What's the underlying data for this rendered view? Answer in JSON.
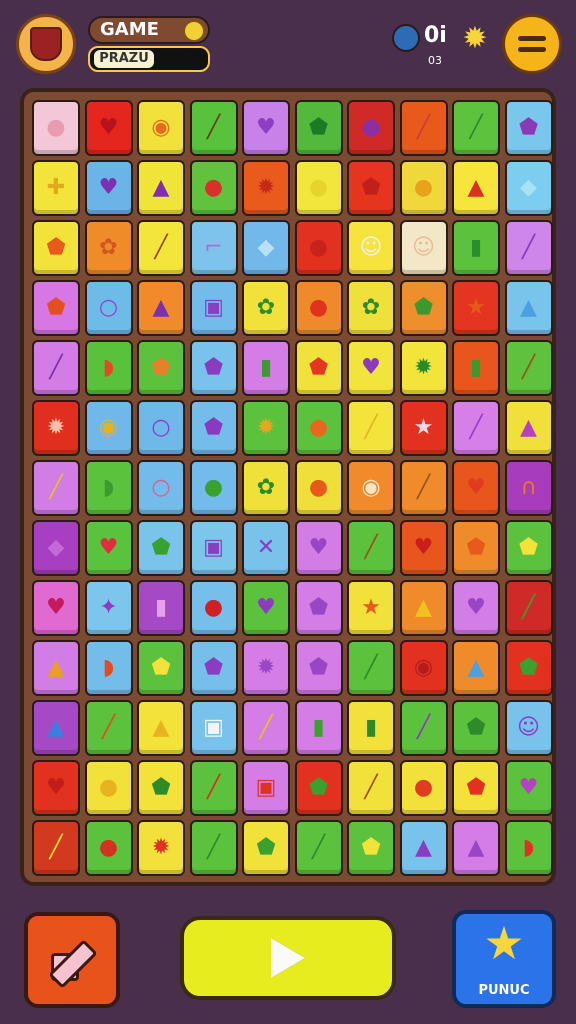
{
  "header": {
    "title": "GAME",
    "subtitle": "PRAZU",
    "stat_value": "0i",
    "stat_sub": "03"
  },
  "buttons": {
    "right_label": "PUNUC"
  },
  "board": {
    "rows": [
      [
        {
          "bg": "#f2c8d8",
          "icon": "●",
          "ic": "#e99bb2"
        },
        {
          "bg": "#e4261e",
          "icon": "♥",
          "ic": "#b5121d"
        },
        {
          "bg": "#f0e23a",
          "icon": "◉",
          "ic": "#e86a1e"
        },
        {
          "bg": "#58c23c",
          "icon": "╱",
          "ic": "#6b3b12"
        },
        {
          "bg": "#c781e8",
          "icon": "♥",
          "ic": "#8d3fc4"
        },
        {
          "bg": "#52b93d",
          "icon": "⬟",
          "ic": "#1b7a26"
        },
        {
          "bg": "#cf2a27",
          "icon": "●",
          "ic": "#8b2fa6"
        },
        {
          "bg": "#e85a1c",
          "icon": "╱",
          "ic": "#d43838"
        },
        {
          "bg": "#5dc23d",
          "icon": "╱",
          "ic": "#2f8a29"
        },
        {
          "bg": "#7ac7ee",
          "icon": "⬟",
          "ic": "#8c39b8"
        }
      ],
      [
        {
          "bg": "#f2e43a",
          "icon": "✚",
          "ic": "#e4a81c"
        },
        {
          "bg": "#6bb4e8",
          "icon": "♥",
          "ic": "#7e2fb3"
        },
        {
          "bg": "#f1e438",
          "icon": "▲",
          "ic": "#7d2fb1"
        },
        {
          "bg": "#61c23e",
          "icon": "●",
          "ic": "#d8312c"
        },
        {
          "bg": "#e95a1c",
          "icon": "✹",
          "ic": "#c42a1a"
        },
        {
          "bg": "#f2e63c",
          "icon": "●",
          "ic": "#e5d42d"
        },
        {
          "bg": "#e6351f",
          "icon": "⬟",
          "ic": "#c21e1a"
        },
        {
          "bg": "#f0d83c",
          "icon": "●",
          "ic": "#e9a31a"
        },
        {
          "bg": "#f6e53b",
          "icon": "▲",
          "ic": "#d8311f"
        },
        {
          "bg": "#7ccdef",
          "icon": "◆",
          "ic": "#a6e3f6"
        }
      ],
      [
        {
          "bg": "#f2e23a",
          "icon": "⬟",
          "ic": "#e85a1c"
        },
        {
          "bg": "#f08b2a",
          "icon": "✿",
          "ic": "#d2571e"
        },
        {
          "bg": "#f3e539",
          "icon": "╱",
          "ic": "#8a4918"
        },
        {
          "bg": "#7ec3ec",
          "icon": "⌐",
          "ic": "#b06ad8"
        },
        {
          "bg": "#72b8ea",
          "icon": "◆",
          "ic": "#b9e1f4"
        },
        {
          "bg": "#e2311f",
          "icon": "●",
          "ic": "#c7221b"
        },
        {
          "bg": "#f6e43d",
          "icon": "☺",
          "ic": "#f1f1f1"
        },
        {
          "bg": "#f2e8c8",
          "icon": "☺",
          "ic": "#e9b99a"
        },
        {
          "bg": "#5cc23e",
          "icon": "▮",
          "ic": "#2b8e2e"
        },
        {
          "bg": "#cf86ea",
          "icon": "╱",
          "ic": "#8c38bd"
        }
      ],
      [
        {
          "bg": "#d677e4",
          "icon": "⬟",
          "ic": "#e34f1f"
        },
        {
          "bg": "#6dbbe9",
          "icon": "○",
          "ic": "#9a40c4"
        },
        {
          "bg": "#f08a2a",
          "icon": "▲",
          "ic": "#7b2fb1"
        },
        {
          "bg": "#72bbeb",
          "icon": "▣",
          "ic": "#8d3bc0"
        },
        {
          "bg": "#f1e13a",
          "icon": "✿",
          "ic": "#2e8f29"
        },
        {
          "bg": "#ee8a2b",
          "icon": "●",
          "ic": "#e0331c"
        },
        {
          "bg": "#f0e03a",
          "icon": "✿",
          "ic": "#2c8a2a"
        },
        {
          "bg": "#ef8e2c",
          "icon": "⬟",
          "ic": "#3a9a2e"
        },
        {
          "bg": "#e3351f",
          "icon": "★",
          "ic": "#e55a1a"
        },
        {
          "bg": "#78c4ec",
          "icon": "▲",
          "ic": "#4aa0e0"
        }
      ],
      [
        {
          "bg": "#d47ce6",
          "icon": "╱",
          "ic": "#7e2fa8"
        },
        {
          "bg": "#58c23c",
          "icon": "◗",
          "ic": "#e54a20"
        },
        {
          "bg": "#5cc23e",
          "icon": "⬟",
          "ic": "#e87f2a"
        },
        {
          "bg": "#78c2ec",
          "icon": "⬟",
          "ic": "#8a3cc0"
        },
        {
          "bg": "#d47de6",
          "icon": "▮",
          "ic": "#3c9a2e"
        },
        {
          "bg": "#f0e23a",
          "icon": "⬟",
          "ic": "#e53620"
        },
        {
          "bg": "#f2e43b",
          "icon": "♥",
          "ic": "#8b3ac0"
        },
        {
          "bg": "#f2e43a",
          "icon": "✹",
          "ic": "#2c8a2a"
        },
        {
          "bg": "#e9561d",
          "icon": "▮",
          "ic": "#3a9a2e"
        },
        {
          "bg": "#5fc23e",
          "icon": "╱",
          "ic": "#9a5418"
        }
      ],
      [
        {
          "bg": "#e02e1f",
          "icon": "✹",
          "ic": "#ffbfa8"
        },
        {
          "bg": "#71b8ea",
          "icon": "◉",
          "ic": "#e8b21f"
        },
        {
          "bg": "#6fb9ea",
          "icon": "○",
          "ic": "#8b3cc0"
        },
        {
          "bg": "#74bdeb",
          "icon": "⬟",
          "ic": "#8a3ac0"
        },
        {
          "bg": "#5cc23e",
          "icon": "✹",
          "ic": "#e8a71f"
        },
        {
          "bg": "#5cc23e",
          "icon": "●",
          "ic": "#e9661f"
        },
        {
          "bg": "#f3e33a",
          "icon": "╱",
          "ic": "#e6b421"
        },
        {
          "bg": "#e2311f",
          "icon": "★",
          "ic": "#f5d8e6"
        },
        {
          "bg": "#d67fe8",
          "icon": "╱",
          "ic": "#9a3fc3"
        },
        {
          "bg": "#f1e03a",
          "icon": "▲",
          "ic": "#b541c3"
        }
      ],
      [
        {
          "bg": "#d27ce6",
          "icon": "╱",
          "ic": "#e8c11f"
        },
        {
          "bg": "#5bc23e",
          "icon": "◗",
          "ic": "#3c9a2e"
        },
        {
          "bg": "#72bbea",
          "icon": "○",
          "ic": "#e25a8f"
        },
        {
          "bg": "#72bbea",
          "icon": "●",
          "ic": "#3aa02e"
        },
        {
          "bg": "#f0e03a",
          "icon": "✿",
          "ic": "#2c8a2a"
        },
        {
          "bg": "#f0de3b",
          "icon": "●",
          "ic": "#e85a1c"
        },
        {
          "bg": "#f08a2a",
          "icon": "◉",
          "ic": "#f5e6c8"
        },
        {
          "bg": "#ef8b2b",
          "icon": "╱",
          "ic": "#9a5418"
        },
        {
          "bg": "#e8561d",
          "icon": "♥",
          "ic": "#e03c1f"
        },
        {
          "bg": "#a73dbd",
          "icon": "∩",
          "ic": "#e87a1f"
        }
      ],
      [
        {
          "bg": "#a83fc2",
          "icon": "◆",
          "ic": "#c46ad8"
        },
        {
          "bg": "#5bc23e",
          "icon": "♥",
          "ic": "#e12e3f"
        },
        {
          "bg": "#7ac4ec",
          "icon": "⬟",
          "ic": "#3aa02e"
        },
        {
          "bg": "#7cc6ec",
          "icon": "▣",
          "ic": "#8d3bc0"
        },
        {
          "bg": "#78c2ec",
          "icon": "✕",
          "ic": "#8b3cc0"
        },
        {
          "bg": "#d27ce6",
          "icon": "♥",
          "ic": "#9a44c6"
        },
        {
          "bg": "#5cc23e",
          "icon": "╱",
          "ic": "#9a5418"
        },
        {
          "bg": "#e9561d",
          "icon": "♥",
          "ic": "#c91e1e"
        },
        {
          "bg": "#ef8b2b",
          "icon": "⬟",
          "ic": "#e85a1c"
        },
        {
          "bg": "#5cc23e",
          "icon": "⬟",
          "ic": "#f2e23a"
        }
      ],
      [
        {
          "bg": "#e06ad2",
          "icon": "♥",
          "ic": "#c41b5c"
        },
        {
          "bg": "#7cc5ec",
          "icon": "✦",
          "ic": "#8b3cc0"
        },
        {
          "bg": "#a54ac4",
          "icon": "▮",
          "ic": "#e7a0ea"
        },
        {
          "bg": "#76bfeb",
          "icon": "●",
          "ic": "#cf2024"
        },
        {
          "bg": "#5cc23e",
          "icon": "♥",
          "ic": "#8d3bc0"
        },
        {
          "bg": "#d47de6",
          "icon": "⬟",
          "ic": "#9a44c6"
        },
        {
          "bg": "#f1e13a",
          "icon": "★",
          "ic": "#e65a1c"
        },
        {
          "bg": "#ef8b2b",
          "icon": "▲",
          "ic": "#f0c41f"
        },
        {
          "bg": "#d37de6",
          "icon": "♥",
          "ic": "#9a44c6"
        },
        {
          "bg": "#cf2a27",
          "icon": "╱",
          "ic": "#3aa02e"
        }
      ],
      [
        {
          "bg": "#d27de6",
          "icon": "▲",
          "ic": "#e9a01f"
        },
        {
          "bg": "#74bdeb",
          "icon": "◗",
          "ic": "#e54a20"
        },
        {
          "bg": "#5cc23e",
          "icon": "⬟",
          "ic": "#f2e23a"
        },
        {
          "bg": "#76bfeb",
          "icon": "⬟",
          "ic": "#8b3cc0"
        },
        {
          "bg": "#d47de6",
          "icon": "✹",
          "ic": "#9a44c6"
        },
        {
          "bg": "#d47de6",
          "icon": "⬟",
          "ic": "#9a44c6"
        },
        {
          "bg": "#5cc23e",
          "icon": "╱",
          "ic": "#2f8a29"
        },
        {
          "bg": "#e2311f",
          "icon": "◉",
          "ic": "#b51d1d"
        },
        {
          "bg": "#ef8b2b",
          "icon": "▲",
          "ic": "#4aa0e0"
        },
        {
          "bg": "#e2311f",
          "icon": "⬟",
          "ic": "#3aa02e"
        }
      ],
      [
        {
          "bg": "#a54ac4",
          "icon": "▲",
          "ic": "#3a7fe0"
        },
        {
          "bg": "#5cc23e",
          "icon": "╱",
          "ic": "#e54a20"
        },
        {
          "bg": "#f2e23a",
          "icon": "▲",
          "ic": "#e9b21f"
        },
        {
          "bg": "#78c2ec",
          "icon": "▣",
          "ic": "#f5f5f5"
        },
        {
          "bg": "#d47de6",
          "icon": "╱",
          "ic": "#e8c11f"
        },
        {
          "bg": "#d47de6",
          "icon": "▮",
          "ic": "#3aa02e"
        },
        {
          "bg": "#f1e13a",
          "icon": "▮",
          "ic": "#2f8a29"
        },
        {
          "bg": "#5cc23e",
          "icon": "╱",
          "ic": "#8b3cc0"
        },
        {
          "bg": "#5cc23e",
          "icon": "⬟",
          "ic": "#2f8a29"
        },
        {
          "bg": "#78c2ec",
          "icon": "☺",
          "ic": "#8b3cc0"
        }
      ],
      [
        {
          "bg": "#e2311f",
          "icon": "♥",
          "ic": "#c41b1b"
        },
        {
          "bg": "#f1e13a",
          "icon": "●",
          "ic": "#e9b21f"
        },
        {
          "bg": "#f2e23a",
          "icon": "⬟",
          "ic": "#2f8a29"
        },
        {
          "bg": "#5cc23e",
          "icon": "╱",
          "ic": "#d4321f"
        },
        {
          "bg": "#d47de6",
          "icon": "▣",
          "ic": "#e0331c"
        },
        {
          "bg": "#e2311f",
          "icon": "⬟",
          "ic": "#3aa02e"
        },
        {
          "bg": "#f1e13a",
          "icon": "╱",
          "ic": "#9a5418"
        },
        {
          "bg": "#f1e13a",
          "icon": "●",
          "ic": "#e03c1f"
        },
        {
          "bg": "#f2e23a",
          "icon": "⬟",
          "ic": "#e2311f"
        },
        {
          "bg": "#5cc23e",
          "icon": "♥",
          "ic": "#b541c3"
        }
      ],
      [
        {
          "bg": "#d3391f",
          "icon": "╱",
          "ic": "#f1e13a"
        },
        {
          "bg": "#5cc23e",
          "icon": "●",
          "ic": "#d4321f"
        },
        {
          "bg": "#f1e13a",
          "icon": "✹",
          "ic": "#e2311f"
        },
        {
          "bg": "#5cc23e",
          "icon": "╱",
          "ic": "#2f8a29"
        },
        {
          "bg": "#f1e13a",
          "icon": "⬟",
          "ic": "#3aa02e"
        },
        {
          "bg": "#5cc23e",
          "icon": "╱",
          "ic": "#2f8a29"
        },
        {
          "bg": "#5cc23e",
          "icon": "⬟",
          "ic": "#f2e23a"
        },
        {
          "bg": "#78c2ec",
          "icon": "▲",
          "ic": "#8b3cc0"
        },
        {
          "bg": "#d47de6",
          "icon": "▲",
          "ic": "#9a44c6"
        },
        {
          "bg": "#5cc23e",
          "icon": "◗",
          "ic": "#e2311f"
        }
      ]
    ]
  },
  "colors": {
    "background": "#4a2f4d",
    "board": "#7a4a33"
  }
}
